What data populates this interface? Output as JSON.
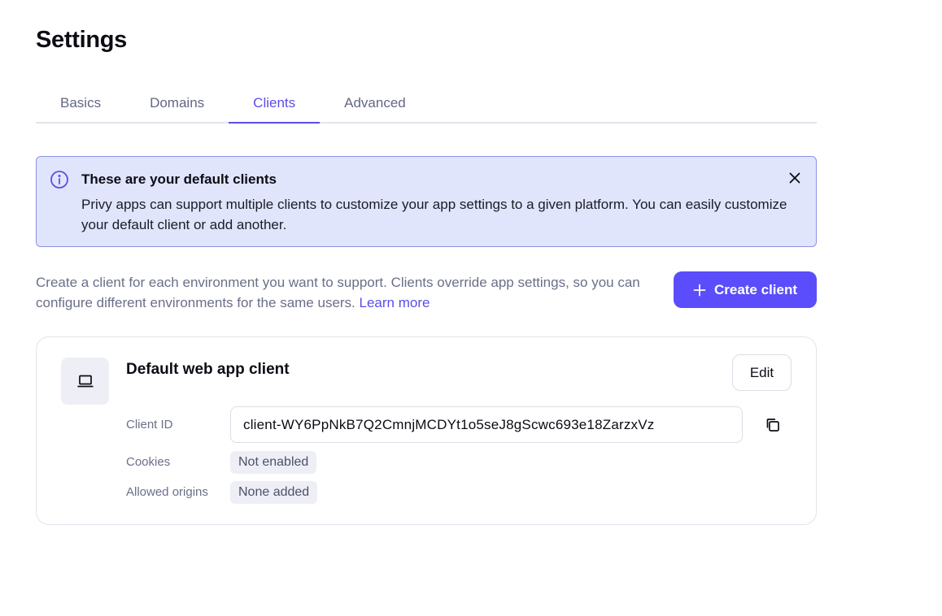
{
  "page": {
    "title": "Settings"
  },
  "tabs": [
    {
      "label": "Basics"
    },
    {
      "label": "Domains"
    },
    {
      "label": "Clients",
      "active": true
    },
    {
      "label": "Advanced"
    }
  ],
  "banner": {
    "title": "These are your default clients",
    "body": "Privy apps can support multiple clients to customize your app settings to a given platform. You can easily customize your default client or add another.",
    "icon": "info-icon",
    "close_icon": "close-icon"
  },
  "description": {
    "text": "Create a client for each environment you want to support. Clients override app settings, so you can configure different environments for the same users.",
    "link": "Learn more"
  },
  "create_button": {
    "label": "Create client",
    "icon": "plus-icon"
  },
  "client_card": {
    "icon": "laptop-icon",
    "title": "Default web app client",
    "edit_label": "Edit",
    "client_id_label": "Client ID",
    "client_id_value": "client-WY6PpNkB7Q2CmnjMCDYt1o5seJ8gScwc693e18ZarzxVz",
    "cookies_label": "Cookies",
    "cookies_value": "Not enabled",
    "origins_label": "Allowed origins",
    "origins_value": "None added"
  },
  "colors": {
    "accent": "#5b4dfb",
    "banner_bg": "#e1e5fc",
    "banner_border": "#8d93e6"
  }
}
